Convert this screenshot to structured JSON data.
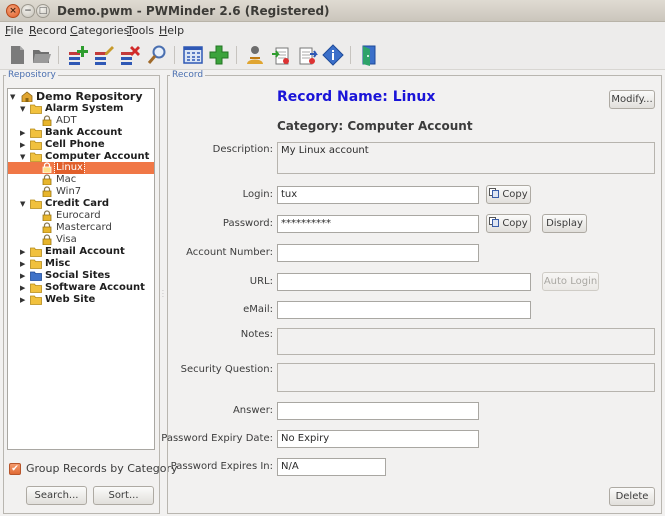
{
  "window": {
    "title": "Demo.pwm - PWMinder 2.6 (Registered)"
  },
  "menu": [
    {
      "label": "File",
      "key": "F",
      "rest": "ile"
    },
    {
      "label": "Record",
      "key": "R",
      "rest": "ecord"
    },
    {
      "label": "Categories",
      "key": "C",
      "rest": "ategories"
    },
    {
      "label": "Tools",
      "key": "T",
      "rest": "ools"
    },
    {
      "label": "Help",
      "key": "H",
      "rest": "elp"
    }
  ],
  "repository": {
    "legend": "Repository",
    "root": "Demo Repository",
    "categories": [
      {
        "label": "Alarm System",
        "expanded": true,
        "records": [
          "ADT"
        ]
      },
      {
        "label": "Bank Account",
        "expanded": false,
        "records": []
      },
      {
        "label": "Cell Phone",
        "expanded": false,
        "records": []
      },
      {
        "label": "Computer Account",
        "expanded": true,
        "records": [
          "Linux",
          "Mac",
          "Win7"
        ]
      },
      {
        "label": "Credit Card",
        "expanded": true,
        "records": [
          "Eurocard",
          "Mastercard",
          "Visa"
        ]
      },
      {
        "label": "Email Account",
        "expanded": false,
        "records": []
      },
      {
        "label": "Misc",
        "expanded": false,
        "records": []
      },
      {
        "label": "Social Sites",
        "expanded": false,
        "records": []
      },
      {
        "label": "Software Account",
        "expanded": false,
        "records": []
      },
      {
        "label": "Web Site",
        "expanded": false,
        "records": []
      }
    ],
    "selected": "Linux",
    "group_label": "Group Records by Category",
    "group_checked": true,
    "search_label": "Search...",
    "sort_label": "Sort..."
  },
  "record": {
    "legend": "Record",
    "name_title": "Record Name: Linux",
    "category_title": "Category: Computer Account",
    "modify_label": "Modify...",
    "delete_label": "Delete",
    "copy_label": "Copy",
    "display_label": "Display",
    "autologin_label": "Auto Login",
    "labels": {
      "description": "Description:",
      "login": "Login:",
      "password": "Password:",
      "account_number": "Account Number:",
      "url": "URL:",
      "email": "eMail:",
      "notes": "Notes:",
      "security_question": "Security Question:",
      "answer": "Answer:",
      "expiry_date": "Password Expiry Date:",
      "expires_in": "Password Expires In:"
    },
    "values": {
      "description": "My Linux account",
      "login": "tux",
      "password": "**********",
      "account_number": "",
      "url": "",
      "email": "",
      "notes": "",
      "security_question": "",
      "answer": "",
      "expiry_date": "No Expiry",
      "expires_in": "N/A"
    }
  },
  "colors": {
    "accent": "#f07746",
    "record_title": "#1a14d8",
    "legend": "#4a6fb0"
  }
}
